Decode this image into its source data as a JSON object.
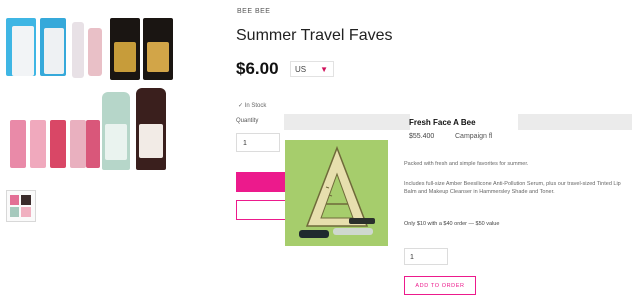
{
  "product": {
    "brand": "BEE BEE",
    "title": "Summer Travel Faves",
    "price": "$6.00",
    "currency": "US",
    "stock": "In Stock",
    "quantity_label": "Quantity",
    "quantity_value": "1"
  },
  "icons": {
    "currency_caret": "chevron-down-icon",
    "stock": "check-icon"
  },
  "colors": {
    "accent": "#ec1a8c",
    "popup_image_bg": "#a6cd6c"
  },
  "popup": {
    "title": "Fresh Face A Bee",
    "subtitle_price": "$55.400",
    "subtitle_link": "Campaign fl",
    "description_1": "Packed with fresh and simple favorites for summer.",
    "description_2": "Includes full-size Amber Beesilicone Anti-Pollution Serum, plus our travel-sized Tinted Lip Balm and Makeup Cleanser in Hammersley Shade and Toner.",
    "offer_line": "Only $10 with a $40 order — $50 value",
    "quantity_value": "1",
    "add_button": "ADD TO ORDER"
  }
}
